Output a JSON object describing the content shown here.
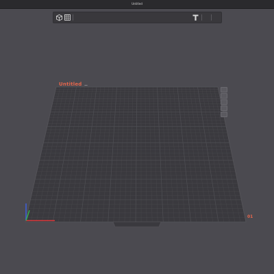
{
  "window": {
    "title": "Untitled"
  },
  "toolbar": {
    "icons": [
      "add-cube-icon",
      "arrange-grid-icon",
      "text-tool-icon"
    ]
  },
  "plate": {
    "name": "Untitled",
    "number": "01",
    "accent_color": "#e6664c",
    "surface_color": "#3a393e",
    "grid_color": "#505055"
  },
  "axes": {
    "x_color": "#d9383b",
    "y_color": "#37b24a",
    "z_color": "#3d5fd6"
  },
  "plate_tools": {
    "icons": [
      "orient-icon",
      "arrange-icon",
      "lock-icon",
      "settings-icon",
      "layers-icon"
    ]
  }
}
